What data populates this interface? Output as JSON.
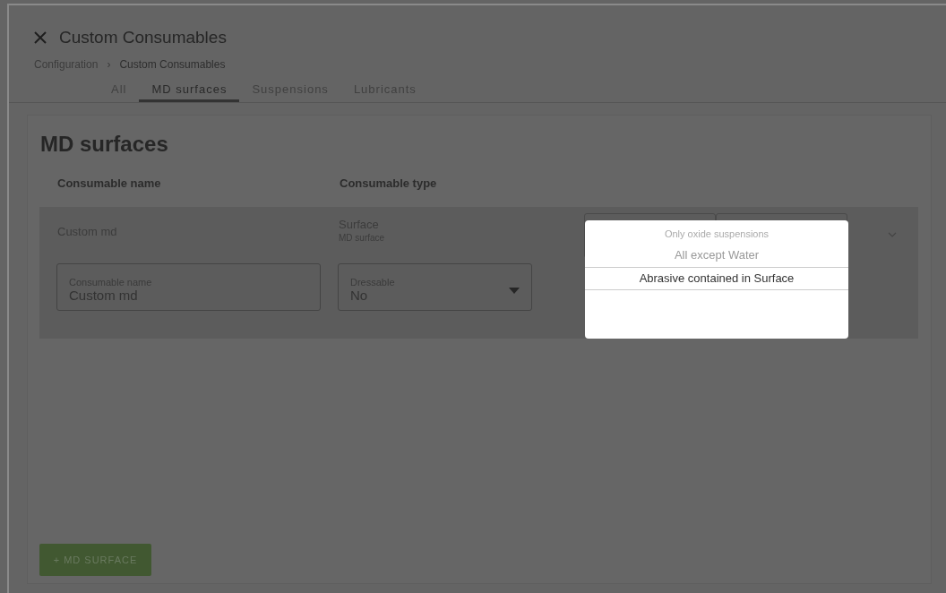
{
  "header": {
    "title": "Custom Consumables",
    "breadcrumb": [
      "Configuration",
      "Custom Consumables"
    ],
    "separator": "›"
  },
  "tabs": [
    {
      "label": "All",
      "selected": false
    },
    {
      "label": "MD surfaces",
      "selected": true
    },
    {
      "label": "Suspensions",
      "selected": false
    },
    {
      "label": "Lubricants",
      "selected": false
    }
  ],
  "section": {
    "title": "MD surfaces",
    "columns": [
      "Consumable name",
      "Consumable type"
    ],
    "row": {
      "name": "Custom md",
      "type": "Surface",
      "subtype": "MD surface",
      "expanded": true,
      "fields": [
        {
          "kind": "text",
          "label": "Consumable name",
          "value": "Custom md"
        },
        {
          "kind": "select",
          "label": "Dressable",
          "value": "No"
        }
      ]
    }
  },
  "picker": {
    "options": [
      {
        "label": "Only oxide suspensions",
        "selected": false
      },
      {
        "label": "All except Water",
        "selected": false
      },
      {
        "label": "Abrasive contained in Surface",
        "selected": true
      }
    ]
  },
  "add_button": "+ MD SURFACE"
}
